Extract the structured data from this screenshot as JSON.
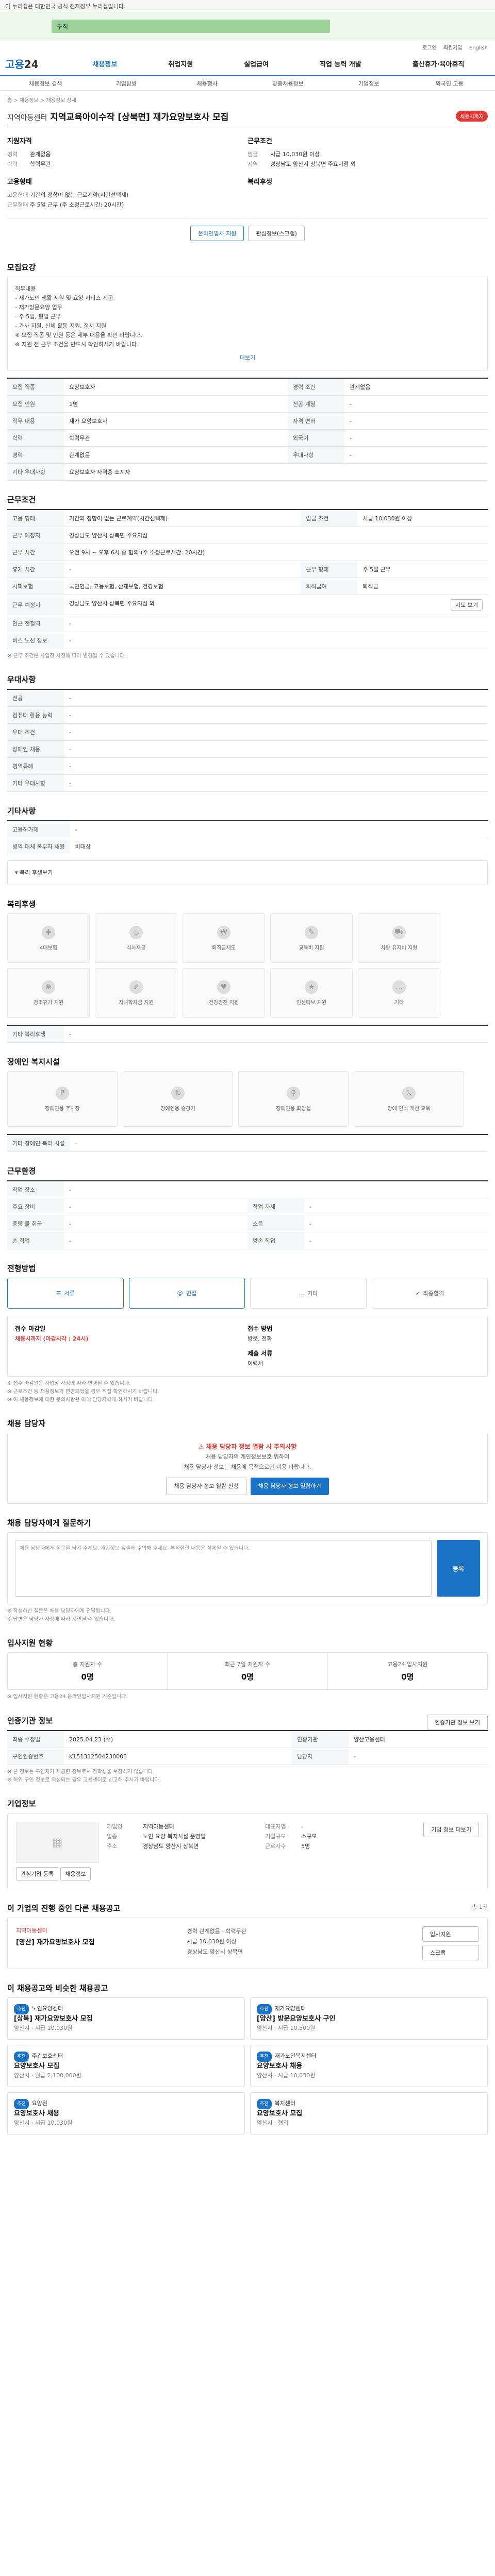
{
  "topbar": {
    "text": "이 누리집은 대한민국 공식 전자정부 누리집입니다."
  },
  "gov": {
    "search_label": "구직"
  },
  "util": [
    "로그인",
    "회원가입",
    "English"
  ],
  "nav": {
    "logo_a": "고용",
    "logo_b": "24",
    "menu": [
      "채용정보",
      "취업지원",
      "실업급여",
      "직업 능력 개발",
      "출산휴가·육아휴직"
    ]
  },
  "subnav": [
    "채용정보 검색",
    "기업탐방",
    "채용행사",
    "맞춤채용정보",
    "기업정보",
    "외국인 고용"
  ],
  "crumb": "홈 > 채용정보 > 채용정보 상세",
  "job": {
    "company": "지역아동센터",
    "title": "지역교육아이수작 [상북면] 재가요양보호사 모집",
    "badge": "채용시까지",
    "qual_title": "지원자격",
    "qual": [
      {
        "k": "경력",
        "v": "관계없음"
      },
      {
        "k": "학력",
        "v": "학력무관"
      }
    ],
    "cond_title": "근무조건",
    "cond": [
      {
        "k": "임금",
        "v": "시급 10,030원 이상"
      },
      {
        "k": "지역",
        "v": "경상남도 양산시 상북면 주요지점 외"
      }
    ],
    "form_title": "고용형태",
    "form": [
      {
        "k": "고용형태",
        "v": "기간의 정함이 없는 근로계약(시간선택제)"
      },
      {
        "k": "근무형태",
        "v": "주 5일 근무 (주 소정근로시간: 20시간)"
      }
    ],
    "welfare_title": "복리후생",
    "btn_apply": "온라인입사 지원",
    "btn_save": "관심정보(스크랩)"
  },
  "detail": {
    "title": "모집요강",
    "text": [
      "직무내용",
      "- 재가노인 생활 지원 및 요양 서비스 제공",
      "- 재가방문요양 업무",
      "- 주 5일, 평일 근무",
      "- 가사 지원, 신체 활동 지원, 정서 지원",
      "※ 모집 직종 및 인원 등은 세부 내용을 확인 바랍니다.",
      "※ 지원 전 근무 조건을 반드시 확인하시기 바랍니다."
    ],
    "more": "더보기"
  },
  "recruit_tbl": {
    "rows": [
      {
        "k1": "모집 직종",
        "v1": "요양보호사",
        "k2": "경력 조건",
        "v2": "관계없음"
      },
      {
        "k1": "모집 인원",
        "v1": "1명",
        "k2": "전공 계열",
        "v2": "-"
      },
      {
        "k1": "직무 내용",
        "v1": "재가 요양보호사",
        "k2": "자격 면허",
        "v2": "-"
      },
      {
        "k1": "학력",
        "v1": "학력무관",
        "k2": "외국어",
        "v2": "-"
      },
      {
        "k1": "경력",
        "v1": "관계없음",
        "k2": "우대사항",
        "v2": "-"
      },
      {
        "k1": "기타 우대사항",
        "v1": "요양보호사 자격증 소지자",
        "k2": "",
        "v2": ""
      }
    ]
  },
  "work": {
    "title": "근무조건",
    "rows": [
      {
        "k1": "고용 형태",
        "v1": "기간의 정함이 없는 근로계약(시간선택제)",
        "k2": "임금 조건",
        "v2": "시급 10,030원 이상"
      },
      {
        "k1": "근무 예정지",
        "v1": "경상남도 양산시 상북면 주요지점",
        "k2": "",
        "v2": ""
      },
      {
        "k1": "근무 시간",
        "v1": "오전 9시 ~ 오후 6시 중 협의 (주 소정근로시간: 20시간)",
        "k2": "",
        "v2": ""
      },
      {
        "k1": "휴게 시간",
        "v1": "-",
        "k2": "근무 형태",
        "v2": "주 5일 근무"
      },
      {
        "k1": "사회보험",
        "v1": "국민연금, 고용보험, 산재보험, 건강보험",
        "k2": "퇴직급여",
        "v2": "퇴직금"
      },
      {
        "k1": "근무 예정지",
        "v1": "경상남도 양산시 상북면 주요지점 외",
        "k2": "",
        "v2": ""
      },
      {
        "k1": "인근 전철역",
        "v1": "-",
        "k2": "",
        "v2": ""
      },
      {
        "k1": "버스 노선 정보",
        "v1": "-",
        "k2": "",
        "v2": ""
      }
    ],
    "note": "※ 근무 조건은 사업장 사정에 따라 변경될 수 있습니다.",
    "map_btn": "지도 보기"
  },
  "pref": {
    "title": "우대사항",
    "rows": [
      {
        "k": "전공",
        "v": "-"
      },
      {
        "k": "컴퓨터 활용 능력",
        "v": "-"
      },
      {
        "k": "우대 조건",
        "v": "-"
      },
      {
        "k": "장애인 채용",
        "v": "-"
      },
      {
        "k": "병역특례",
        "v": "-"
      },
      {
        "k": "기타 우대사항",
        "v": "-"
      }
    ]
  },
  "etc": {
    "title": "기타사항",
    "rows": [
      {
        "k": "고용허가제",
        "v": "-"
      },
      {
        "k": "병역 대체 복무자 채용",
        "v": "비대상"
      }
    ],
    "toggle": "복리 후생보기"
  },
  "welfare": {
    "title": "복리후생",
    "cards": [
      "4대보험",
      "식사제공",
      "퇴직금제도",
      "교육비 지원",
      "차량 유지비 지원",
      "경조휴가 지원",
      "자녀학자금 지원",
      "건강검진 지원",
      "인센티브 지원",
      "기타"
    ],
    "extra_k": "기타 복리후생",
    "extra_v": "-"
  },
  "disabled": {
    "title": "장애인 복지시설",
    "cards": [
      "장애인용 주차장",
      "장애인용 승강기",
      "장애인용 화장실",
      "장애 인식 개선 교육"
    ],
    "extra_k": "기타 장애인 복리 시설",
    "extra_v": "-"
  },
  "worker": {
    "title": "근무환경",
    "rows": [
      {
        "k1": "작업 장소",
        "v1": "-",
        "k2": "",
        "v2": ""
      },
      {
        "k1": "주요 장비",
        "v1": "-",
        "k2": "작업 자세",
        "v2": "-"
      },
      {
        "k1": "중량 물 취급",
        "v1": "-",
        "k2": "소음",
        "v2": "-"
      },
      {
        "k1": "손 작업",
        "v1": "-",
        "k2": "양손 작업",
        "v2": "-"
      }
    ]
  },
  "process": {
    "title": "전형방법",
    "steps": [
      "서류",
      "면접",
      "기타",
      "최종합격"
    ]
  },
  "howto": {
    "a_title": "접수 마감일",
    "a_v1": "채용시까지 (마감시각 : 24시)",
    "a_note": "",
    "b_title": "접수 방법",
    "b_v": "방문, 전화",
    "c_title": "제출 서류",
    "c_v": "이력서",
    "notes": [
      "※ 접수 마감일은 사업장 사정에 따라 변경될 수 있습니다.",
      "※ 근로조건 등 채용정보가 변경되었을 경우 직접 확인하시기 바랍니다.",
      "※ 이 채용정보에 대한 문의사항은 아래 담당자에게 하시기 바랍니다."
    ]
  },
  "contact": {
    "title": "채용 담당자",
    "head": "채용 담당자 정보 열람 시 주의사항",
    "lines": [
      "채용 담당자의 개인정보보호 위하여",
      "채용 담당자 정보는 채용에 목적으로만 이용 바랍니다."
    ],
    "btn_a": "채용 담당자 정보 열람 신청",
    "btn_b": "채용 담당자 정보 열람하기"
  },
  "qa": {
    "title": "채용 담당자에게 질문하기",
    "placeholder": "채용 담당자에게 질문을 남겨 주세요. 개인정보 유출에 주의해 주세요. 부적절한 내용은 삭제될 수 있습니다.",
    "send": "등록",
    "notes": [
      "※ 작성하신 질문은 채용 담당자에게 전달됩니다.",
      "※ 답변은 담당자 사정에 따라 지연될 수 있습니다."
    ]
  },
  "stats": {
    "title": "입사지원 현황",
    "items": [
      {
        "l": "총 지원자 수",
        "n": "0명"
      },
      {
        "l": "최근 7일 지원자 수",
        "n": "0명"
      },
      {
        "l": "고용24 입사지원",
        "n": "0명"
      }
    ],
    "note": "※ 입사지원 현황은 고용24 온라인입사지원 기준입니다."
  },
  "meta": {
    "title": "인증기관 정보",
    "btn": "인증기관 정보 보기",
    "rows": [
      {
        "k1": "최종 수정일",
        "v1": "2025.04.23 (수)",
        "k2": "인증기관",
        "v2": "양산고용센터"
      },
      {
        "k1": "구인인증번호",
        "v1": "K151312504230003",
        "k2": "담당자",
        "v2": "-"
      }
    ],
    "notes": [
      "※ 본 정보는 구인자가 제공한 정보로서 정확성을 보장하지 않습니다.",
      "※ 허위 구인 정보로 의심되는 경우 고용센터로 신고해 주시기 바랍니다."
    ]
  },
  "company": {
    "title": "기업정보",
    "btn": "기업 정보 더보기",
    "rows": [
      {
        "k": "기업명",
        "v": "지역아동센터"
      },
      {
        "k": "업종",
        "v": "노인 요양 복지시설 운영업"
      },
      {
        "k": "주소",
        "v": "경상남도 양산시 상북면"
      },
      {
        "k": "대표자명",
        "v": "-"
      },
      {
        "k": "기업규모",
        "v": "소규모"
      },
      {
        "k": "근로자수",
        "v": "5명"
      }
    ],
    "b1": "관심기업 등록",
    "b2": "채용정보"
  },
  "ongoing": {
    "title": "이 기업의 진행 중인 다른 채용공고",
    "count": "총 1건",
    "company": "지역아동센터",
    "name": "[양산] 재가요양보호사 모집",
    "meta": [
      "경력 관계없음 · 학력무관",
      "시급 10,030원 이상",
      "경상남도 양산시 상북면"
    ],
    "b1": "입사지원",
    "b2": "스크랩"
  },
  "recs": {
    "title": "이 채용공고와 비슷한 채용공고",
    "items": [
      {
        "tag": "추천",
        "company": "노인요양센터",
        "name": "[상북] 재가요양보호사 모집",
        "meta": "양산시 · 시급 10,030원"
      },
      {
        "tag": "추천",
        "company": "재가요양센터",
        "name": "[양산] 방문요양보호사 구인",
        "meta": "양산시 · 시급 10,500원"
      },
      {
        "tag": "추천",
        "company": "주간보호센터",
        "name": "요양보호사 모집",
        "meta": "양산시 · 월급 2,100,000원"
      },
      {
        "tag": "추천",
        "company": "재가노인복지센터",
        "name": "요양보호사 채용",
        "meta": "양산시 · 시급 10,030원"
      },
      {
        "tag": "추천",
        "company": "요양원",
        "name": "요양보호사 채용",
        "meta": "양산시 · 시급 10,030원"
      },
      {
        "tag": "추천",
        "company": "복지센터",
        "name": "요양보호사 모집",
        "meta": "양산시 · 협의"
      }
    ]
  }
}
